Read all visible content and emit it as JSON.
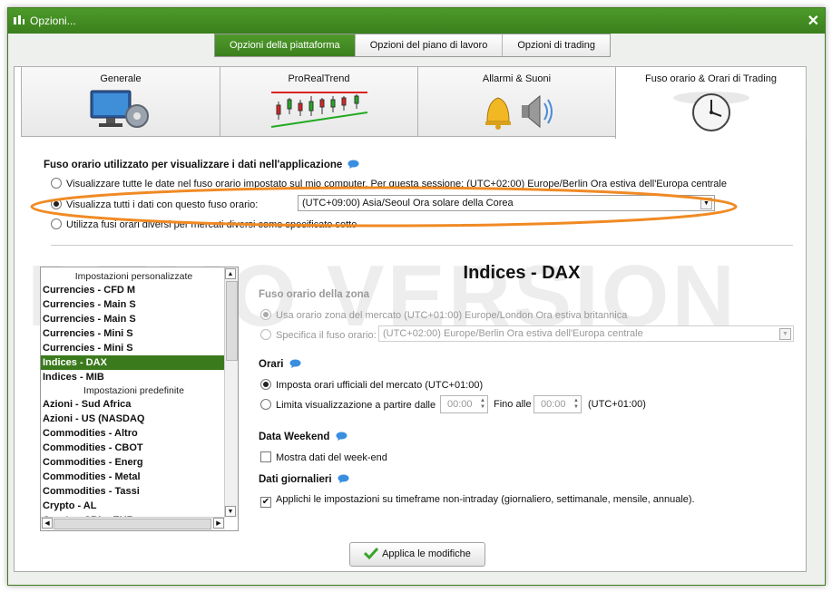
{
  "window": {
    "title": "Opzioni...",
    "close_label": "✕"
  },
  "top_tabs": [
    {
      "label": "Opzioni della piattaforma"
    },
    {
      "label": "Opzioni del piano di lavoro"
    },
    {
      "label": "Opzioni di trading"
    }
  ],
  "category_tabs": [
    {
      "label": "Generale",
      "icon": "computer-gear-icon"
    },
    {
      "label": "ProRealTrend",
      "icon": "trend-chart-icon"
    },
    {
      "label": "Allarmi & Suoni",
      "icon": "bell-speaker-icon"
    },
    {
      "label": "Fuso orario & Orari di Trading",
      "icon": "clock-icon"
    }
  ],
  "timezone_section": {
    "title": "Fuso orario utilizzato per visualizzare i dati nell'applicazione",
    "option1": "Visualizzare tutte le date nel fuso orario impostato sul mio computer. Per questa sessione: (UTC+02:00) Europe/Berlin Ora estiva dell'Europa centrale",
    "option2": "Visualizza tutti i dati con questo fuso orario:",
    "option2_value": "(UTC+09:00) Asia/Seoul Ora solare della Corea",
    "option3": "Utilizza fusi orari diversi per mercati diversi come specificato sotto"
  },
  "watermark": "DEMO VERSION",
  "list": {
    "group1": "Impostazioni personalizzate",
    "custom_items": [
      "Currencies - CFD M",
      "Currencies - Main S",
      "Currencies - Main S",
      "Currencies - Mini S",
      "Currencies - Mini S",
      "Indices - DAX",
      "Indices - MIB"
    ],
    "group2": "Impostazioni predefinite",
    "default_items": [
      "Azioni - Sud Africa",
      "Azioni - US (NASDAQ",
      "Commodities - Altro",
      "Commodities - CBOT",
      "Commodities - Energ",
      "Commodities - Metal",
      "Commodities - Tassi",
      "Crypto - AL",
      "Crypto - CBL - EUR"
    ],
    "selected": "Indices - DAX"
  },
  "detail": {
    "heading": "Indices - DAX",
    "zone_title": "Fuso orario della zona",
    "zone_opt1": "Usa orario zona del mercato (UTC+01:00) Europe/London Ora estiva britannica",
    "zone_opt2": "Specifica il fuso orario:",
    "zone_opt2_value": "(UTC+02:00) Europe/Berlin Ora estiva dell'Europa centrale",
    "hours_title": "Orari",
    "hours_opt1": "Imposta orari ufficiali del mercato  (UTC+01:00)",
    "hours_opt2": "Limita visualizzazione  a partire dalle",
    "from_time": "00:00",
    "until_label": "Fino alle",
    "until_time": "00:00",
    "tz_suffix": "(UTC+01:00)",
    "weekend_title": "Data Weekend",
    "weekend_opt": "Mostra dati del week-end",
    "daily_title": "Dati giornalieri",
    "daily_opt": "Applichi le impostazioni su timeframe non-intraday (giornaliero, settimanale, mensile, annuale)."
  },
  "apply_button": "Applica le modifiche",
  "colors": {
    "accent_green": "#3b7a1c",
    "highlight_orange": "#f08a24"
  }
}
